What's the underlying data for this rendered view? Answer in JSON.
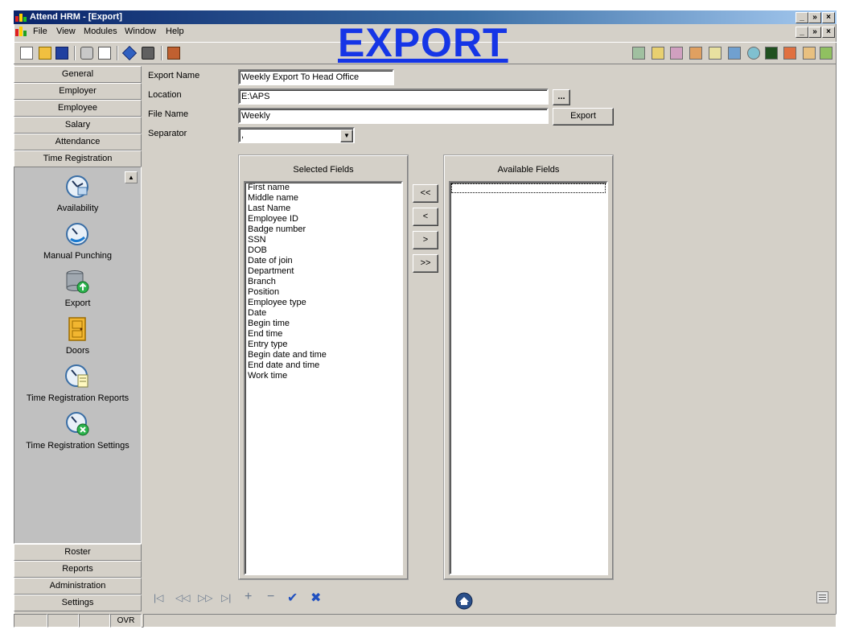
{
  "window": {
    "title": "Attend HRM - [Export]",
    "caption_buttons": [
      "_",
      "»",
      "×"
    ]
  },
  "banner": "EXPORT",
  "menu": [
    "File",
    "View",
    "Modules",
    "Window",
    "Help"
  ],
  "nav_top": [
    "General",
    "Employer",
    "Employee",
    "Salary",
    "Attendance",
    "Time Registration"
  ],
  "nav_items": [
    {
      "label": "Availability",
      "icon": "availability-icon"
    },
    {
      "label": "Manual Punching",
      "icon": "manual-punching-icon"
    },
    {
      "label": "Export",
      "icon": "export-database-icon"
    },
    {
      "label": "Doors",
      "icon": "door-icon"
    },
    {
      "label": "Time Registration Reports",
      "icon": "reports-clock-icon"
    },
    {
      "label": "Time Registration Settings",
      "icon": "settings-clock-icon"
    }
  ],
  "nav_bottom": [
    "Roster",
    "Reports",
    "Administration",
    "Settings"
  ],
  "form": {
    "export_name_label": "Export Name",
    "export_name_value": "Weekly Export To Head Office",
    "location_label": "Location",
    "location_value": "E:\\APS",
    "browse_label": "...",
    "file_name_label": "File Name",
    "file_name_value": "Weekly",
    "export_button": "Export",
    "separator_label": "Separator",
    "separator_value": ","
  },
  "selected_fields": {
    "title": "Selected Fields",
    "items": [
      "First name",
      "Middle name",
      "Last Name",
      "Employee ID",
      "Badge number",
      "SSN",
      "DOB",
      "Date of join",
      "Department",
      "Branch",
      "Position",
      "Employee type",
      "Date",
      "Begin time",
      "End time",
      "Entry type",
      "Begin date and time",
      "End date and time",
      "Work time"
    ]
  },
  "available_fields": {
    "title": "Available Fields",
    "items": []
  },
  "move_buttons": [
    "<<",
    "<",
    ">",
    ">>"
  ],
  "record_nav": [
    "|◁",
    "◁◁",
    "▷▷",
    "▷|",
    "+",
    "−",
    "✔",
    "✖"
  ],
  "status": {
    "ovr": "OVR"
  },
  "colors": {
    "face": "#d4d0c8",
    "title_start": "#0a246a",
    "banner": "#1535e6"
  }
}
